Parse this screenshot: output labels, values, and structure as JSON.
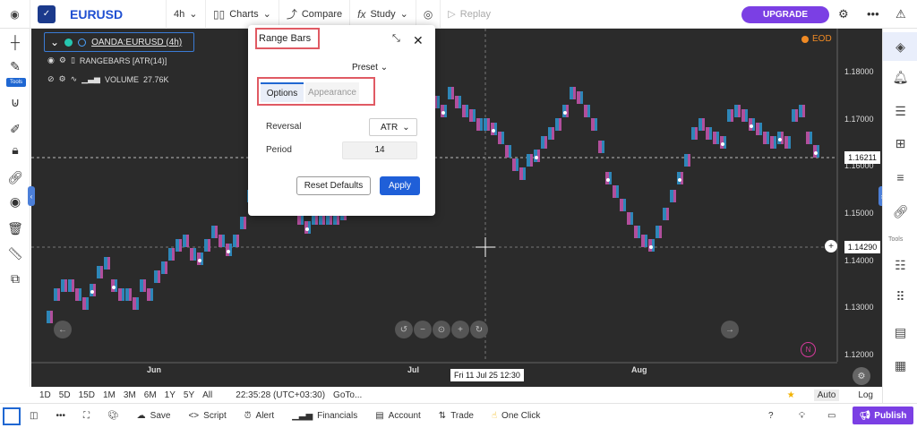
{
  "topbar": {
    "symbol": "EURUSD",
    "interval": "4h",
    "charts_label": "Charts",
    "compare_label": "Compare",
    "study_label": "Study",
    "replay_label": "Replay",
    "upgrade_label": "UPGRADE"
  },
  "left_toolbar": {
    "tools_badge": "Tools"
  },
  "chart": {
    "legend_symbol": "OANDA:EURUSD (4h)",
    "indicator_1": "RANGEBARS [ATR(14)]",
    "indicator_2_name": "VOLUME",
    "indicator_2_value": "27.76K",
    "eod_label": "EOD",
    "price_labels": [
      "1.18000",
      "1.17000",
      "1.16000",
      "1.15000",
      "1.14000",
      "1.13000",
      "1.12000"
    ],
    "current_price_tag": "1.16211",
    "crosshair_price_tag": "1.14290",
    "time_labels": [
      "Jun",
      "Jul",
      "Aug"
    ],
    "crosshair_time_tag": "Fri 11 Jul 25  12:30",
    "n_badge": "N",
    "colors": {
      "up": "#2e86b8",
      "down": "#b14f9c",
      "background": "#2b2b2b"
    }
  },
  "dialog": {
    "title": "Range Bars",
    "preset_label": "Preset",
    "tabs": [
      "Options",
      "Appearance"
    ],
    "reversal_label": "Reversal",
    "reversal_value": "ATR",
    "period_label": "Period",
    "period_value": "14",
    "reset_label": "Reset Defaults",
    "apply_label": "Apply"
  },
  "range_selector": {
    "ranges": [
      "1D",
      "5D",
      "15D",
      "1M",
      "3M",
      "6M",
      "1Y",
      "5Y",
      "All"
    ],
    "time": "22:35:28 (UTC+03:30)",
    "goto_label": "GoTo...",
    "auto_label": "Auto",
    "log_label": "Log"
  },
  "bottom_toolbar": {
    "save_label": "Save",
    "script_label": "Script",
    "alert_label": "Alert",
    "financials_label": "Financials",
    "account_label": "Account",
    "trade_label": "Trade",
    "oneclick_label": "One Click",
    "publish_label": "Publish"
  },
  "right_toolbar": {
    "tools_label": "Tools"
  }
}
